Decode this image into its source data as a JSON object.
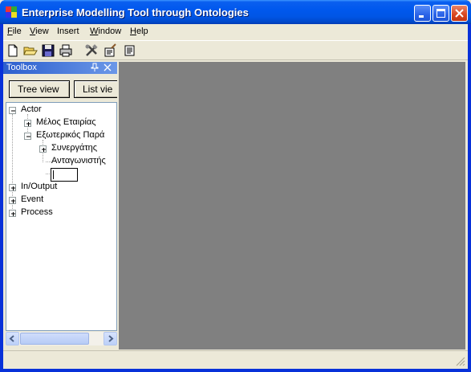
{
  "window": {
    "title": "Enterprise Modelling Tool through Ontologies",
    "accent": "#0055e5",
    "close_color": "#d9461f"
  },
  "menu": {
    "items": [
      {
        "label": "File",
        "underline": "F"
      },
      {
        "label": "View",
        "underline": "V"
      },
      {
        "label": "Insert",
        "underline": ""
      },
      {
        "label": "Window",
        "underline": "W"
      },
      {
        "label": "Help",
        "underline": "H"
      }
    ]
  },
  "toolbar": {
    "icons": [
      "new-file-icon",
      "open-folder-icon",
      "save-icon",
      "print-icon",
      "tools-icon",
      "properties-icon",
      "document-icon"
    ]
  },
  "toolbox": {
    "title": "Toolbox",
    "tree_view_label": "Tree view",
    "list_view_label": "List vie",
    "tree": {
      "actor": "Actor",
      "melos": "Μέλος Εταιρίας",
      "exoterikos": "Εξωτερικός Παρά",
      "synergatis": "Συνεργάτης",
      "antagonistis": "Ανταγωνιστής",
      "new_node_value": "",
      "inoutput": "In/Output",
      "event": "Event",
      "process": "Process"
    }
  },
  "workspace": {
    "background": "#808080"
  },
  "statusbar": {
    "text": ""
  }
}
